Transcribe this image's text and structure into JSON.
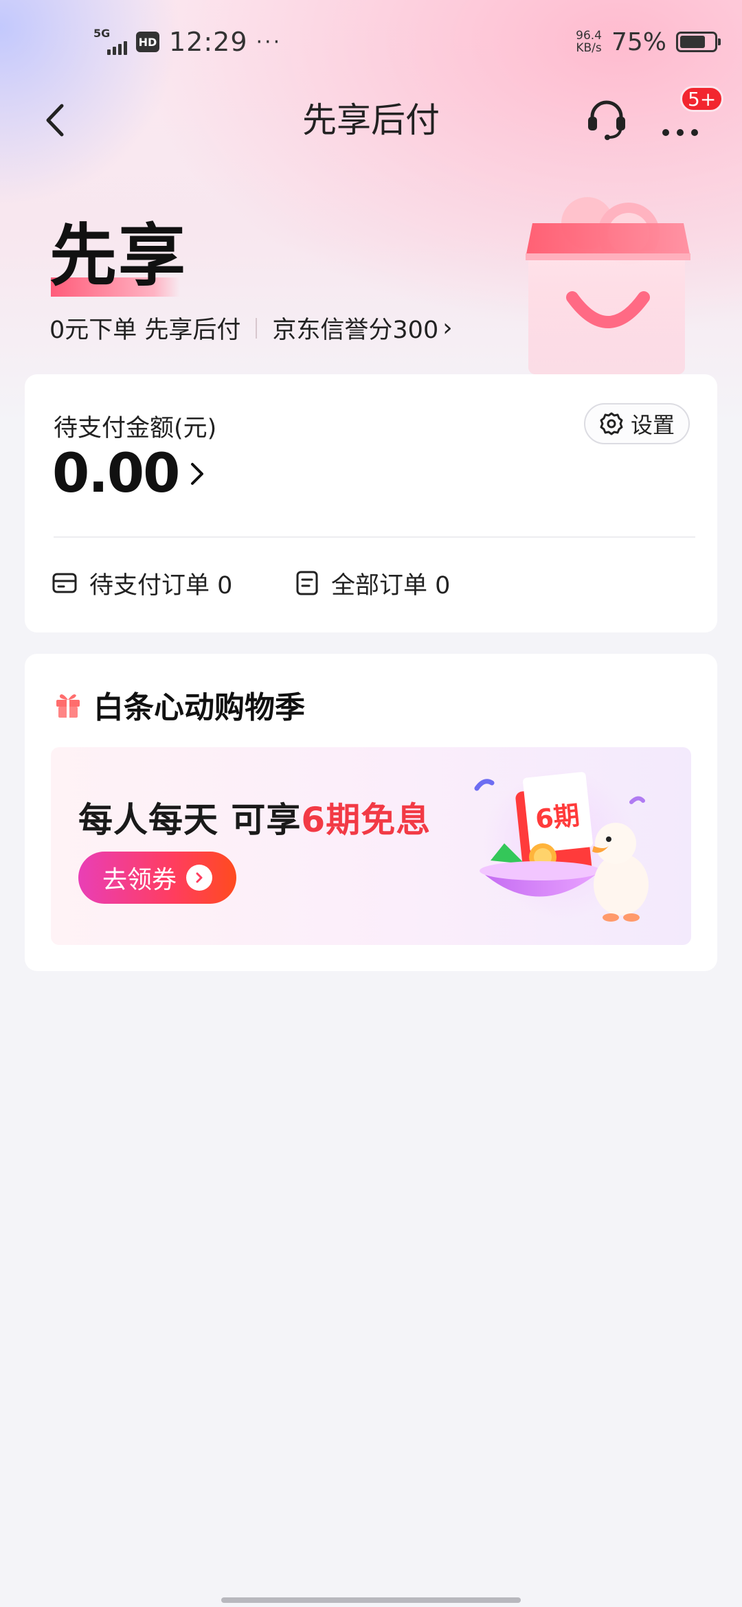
{
  "status_bar": {
    "network": "5G",
    "hd": "HD",
    "time": "12:29",
    "more": "···",
    "speed_value": "96.4",
    "speed_unit": "KB/s",
    "battery_pct": "75%",
    "battery_level": 0.75
  },
  "nav": {
    "title": "先享后付",
    "badge": "5+"
  },
  "hero": {
    "title": "先享",
    "subtitle": "0元下单 先享后付",
    "credit": "京东信誉分300",
    "chevron": "›"
  },
  "pay_card": {
    "label": "待支付金额(元)",
    "amount": "0.00",
    "setting_label": "设置",
    "pending_orders": "待支付订单 0",
    "all_orders": "全部订单 0"
  },
  "promo": {
    "section_title": "白条心动购物季",
    "banner_text_a": "每人每天 可享",
    "banner_text_highlight": "6期免息",
    "button_label": "去领券",
    "art_label": "6期"
  },
  "colors": {
    "accent_red": "#f23a45",
    "badge_red": "#f2262f",
    "button_gradient_start": "#e93fb6",
    "button_gradient_end": "#ff4b1f"
  },
  "icons": [
    "back-arrow-icon",
    "headset-icon",
    "more-dots-icon",
    "shopping-bag-icon",
    "gear-icon",
    "chevron-right-icon",
    "card-icon",
    "document-icon",
    "gift-icon",
    "arrow-circle-icon"
  ]
}
